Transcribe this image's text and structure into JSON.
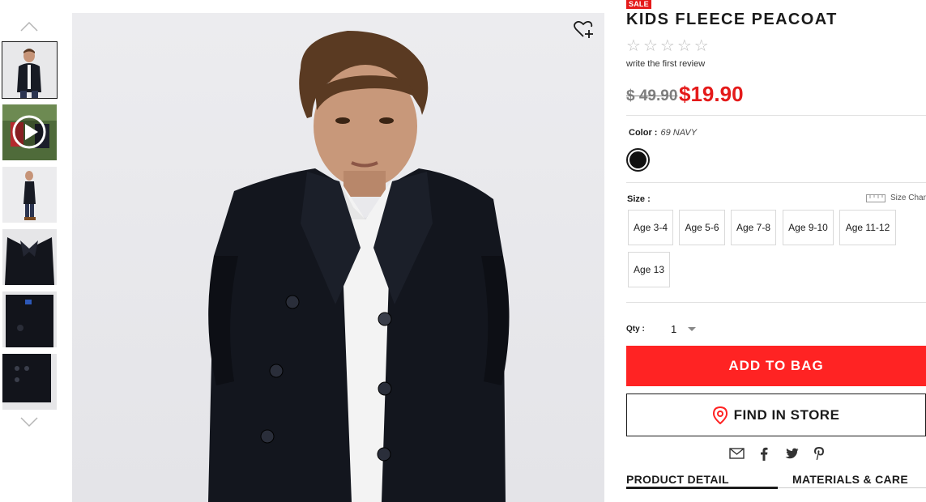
{
  "product": {
    "badge": "SALE",
    "title": "KIDS FLEECE PEACOAT",
    "stars": [
      "☆",
      "☆",
      "☆",
      "☆",
      "☆"
    ],
    "review_link": "write the first review",
    "price_original": "$ 49.90",
    "price_sale": "$19.90"
  },
  "color": {
    "label": "Color :",
    "value": "69 NAVY",
    "swatch_hex": "#111111"
  },
  "size": {
    "label": "Size :",
    "chart_label": "Size Chart",
    "options": [
      "Age 3-4",
      "Age 5-6",
      "Age 7-8",
      "Age 9-10",
      "Age 11-12",
      "Age 13"
    ]
  },
  "qty": {
    "label": "Qty :",
    "value": "1"
  },
  "actions": {
    "add_to_bag": "ADD TO BAG",
    "find_in_store": "FIND IN STORE"
  },
  "share_icons": [
    "email-icon",
    "facebook-icon",
    "twitter-icon",
    "pinterest-icon"
  ],
  "tabs": [
    "PRODUCT DETAIL",
    "MATERIALS & CARE"
  ],
  "thumbnails": [
    "front-view",
    "video",
    "side-view",
    "collar-detail",
    "lining-detail",
    "button-detail"
  ],
  "colors": {
    "accent": "#ff2323",
    "sale_red": "#e41a1a",
    "text": "#1b1b1b"
  }
}
